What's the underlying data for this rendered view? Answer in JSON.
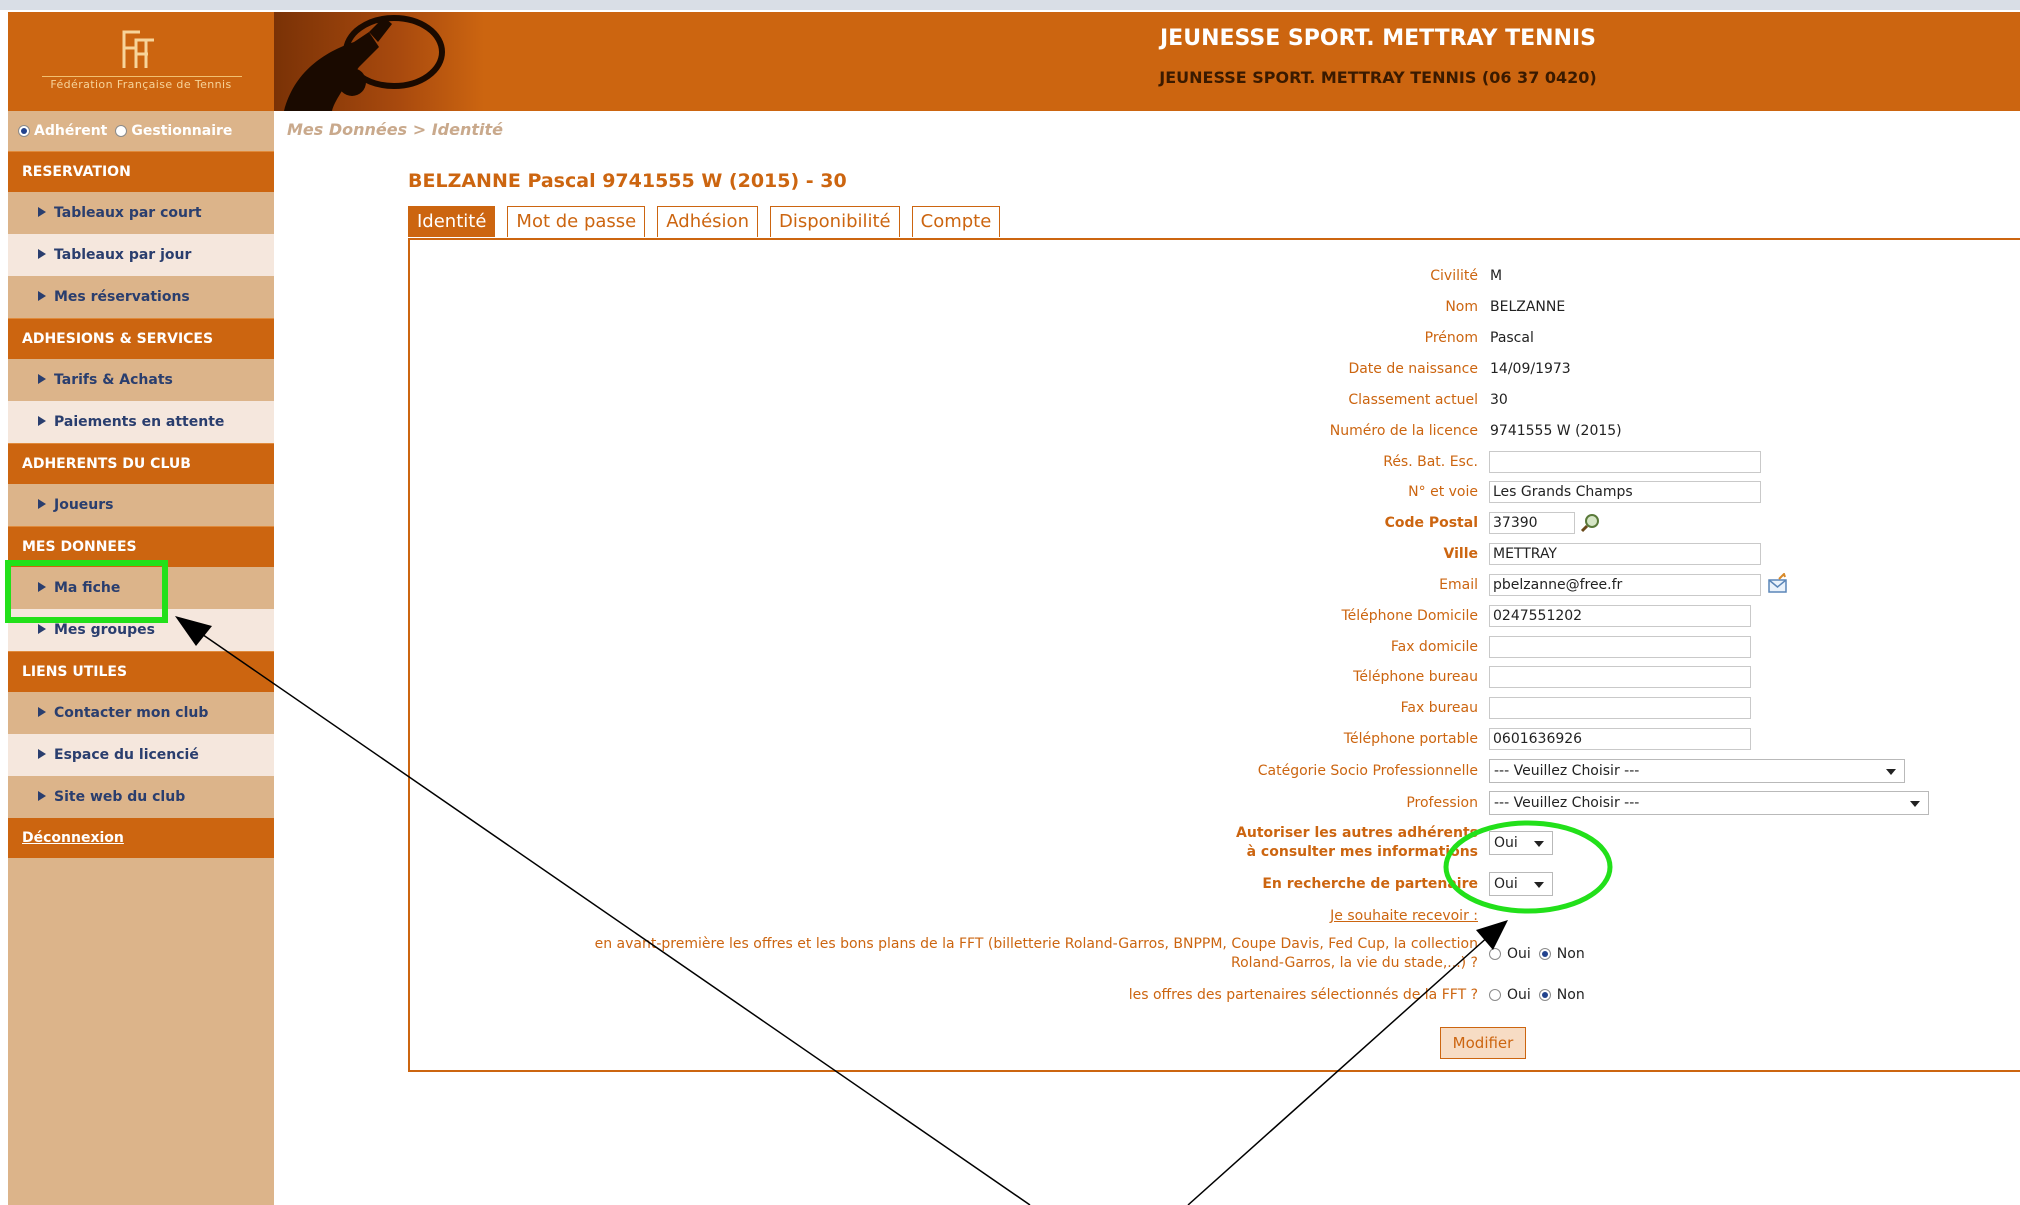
{
  "header": {
    "logo_text": "Fédération Française de Tennis",
    "club_title": "JEUNESSE SPORT. METTRAY TENNIS",
    "club_subtitle": "JEUNESSE SPORT. METTRAY TENNIS (06 37 0420)"
  },
  "profile_toggle": {
    "option1": "Adhérent",
    "option2": "Gestionnaire",
    "selected": "Adhérent"
  },
  "sidebar": {
    "sections": [
      {
        "title": "RESERVATION",
        "items": [
          "Tableaux par court",
          "Tableaux par jour",
          "Mes réservations"
        ]
      },
      {
        "title": "ADHESIONS & SERVICES",
        "items": [
          "Tarifs & Achats",
          "Paiements en attente"
        ]
      },
      {
        "title": "ADHERENTS DU CLUB",
        "items": [
          "Joueurs"
        ]
      },
      {
        "title": "MES DONNEES",
        "items": [
          "Ma fiche",
          "Mes groupes"
        ]
      },
      {
        "title": "LIENS UTILES",
        "items": [
          "Contacter mon club",
          "Espace du licencié",
          "Site web du club"
        ]
      }
    ],
    "logout": "Déconnexion"
  },
  "breadcrumb": "Mes Données > Identité",
  "member_title": "BELZANNE Pascal 9741555 W (2015) - 30",
  "tabs": [
    "Identité",
    "Mot de passe",
    "Adhésion",
    "Disponibilité",
    "Compte"
  ],
  "form": {
    "civilite_label": "Civilité",
    "civilite": "M",
    "nom_label": "Nom",
    "nom": "BELZANNE",
    "prenom_label": "Prénom",
    "prenom": "Pascal",
    "naissance_label": "Date de naissance",
    "naissance": "14/09/1973",
    "classement_label": "Classement actuel",
    "classement": "30",
    "licence_label": "Numéro de la licence",
    "licence": "9741555 W (2015)",
    "res_label": "Rés. Bat. Esc.",
    "res": "",
    "voie_label": "N° et voie",
    "voie": "Les Grands Champs",
    "cp_label": "Code Postal",
    "cp": "37390",
    "ville_label": "Ville",
    "ville": "METTRAY",
    "email_label": "Email",
    "email": "pbelzanne@free.fr",
    "tel_dom_label": "Téléphone Domicile",
    "tel_dom": "0247551202",
    "fax_dom_label": "Fax domicile",
    "fax_dom": "",
    "tel_bureau_label": "Téléphone bureau",
    "tel_bureau": "",
    "fax_bureau_label": "Fax bureau",
    "fax_bureau": "",
    "tel_port_label": "Téléphone portable",
    "tel_port": "0601636926",
    "csp_label": "Catégorie Socio Professionnelle",
    "csp": "--- Veuillez Choisir ---",
    "profession_label": "Profession",
    "profession": "--- Veuillez Choisir ---",
    "autoriser_label_1": "Autoriser les autres adhérents",
    "autoriser_label_2": "à consulter mes informations",
    "autoriser": "Oui",
    "partenaire_label": "En recherche de partenaire",
    "partenaire": "Oui",
    "recevoir_label": "Je souhaite recevoir :",
    "offres_fft_1": "en avant-première les offres et les bons plans de la FFT (billetterie Roland-Garros, BNPPM, Coupe Davis, Fed Cup, la collection",
    "offres_fft_2": "Roland-Garros, la vie du stade,...) ?",
    "offres_part": "les offres des partenaires sélectionnés de la FFT ?",
    "oui": "Oui",
    "non": "Non",
    "submit": "Modifier"
  },
  "colors": {
    "brand": "#cc6510",
    "sidebar_bg": "#dcb48a",
    "highlight": "#22e01a"
  }
}
